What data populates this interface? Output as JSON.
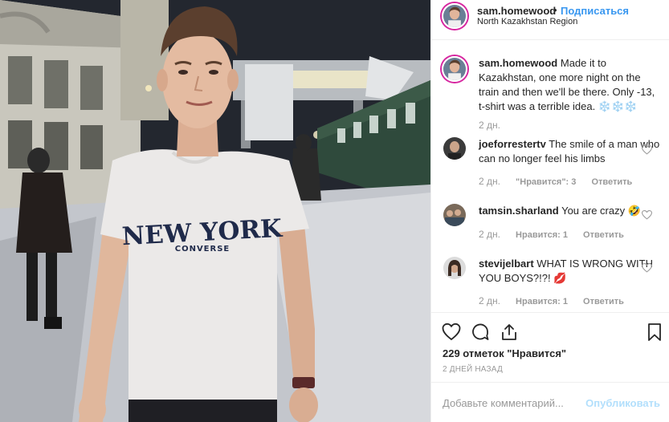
{
  "post": {
    "username": "sam.homewood",
    "follow_label": "Подписаться",
    "dot": "•",
    "location": "North Kazakhstan Region",
    "caption": {
      "username": "sam.homewood",
      "text": "Made it to Kazakhstan, one more night on the train and then we'll be there. Only -13, t-shirt was a terrible idea. ❄️❄️❄️",
      "time": "2 дн."
    },
    "comments": [
      {
        "username": "joeforrestertv",
        "text": "The smile of a man who can no longer feel his limbs",
        "time": "2 дн.",
        "likes": "\"Нравится\": 3",
        "reply": "Ответить"
      },
      {
        "username": "tamsin.sharland",
        "text": "You are crazy 🤣",
        "time": "2 дн.",
        "likes": "Нравится: 1",
        "reply": "Ответить"
      },
      {
        "username": "stevijelbart",
        "text": "WHAT IS WRONG WITH YOU BOYS?!?! 💋",
        "time": "2 дн.",
        "likes": "Нравится: 1",
        "reply": "Ответить"
      }
    ],
    "likes_count": "229 отметок \"Нравится\"",
    "posted_ago": "2 ДНЕЙ НАЗАД",
    "comment_placeholder": "Добавьте комментарий...",
    "publish_label": "Опубликовать",
    "shirt_text_top": "NEW YORK",
    "shirt_text_bottom": "CONVERSE"
  },
  "icons": {
    "like": "heart-outline-icon",
    "comment": "speech-bubble-icon",
    "share": "share-icon",
    "save": "bookmark-icon"
  },
  "colors": {
    "accent": "#3897f0",
    "publish_disabled": "#b2dffc",
    "meta_gray": "#999999",
    "border": "#efefef"
  }
}
